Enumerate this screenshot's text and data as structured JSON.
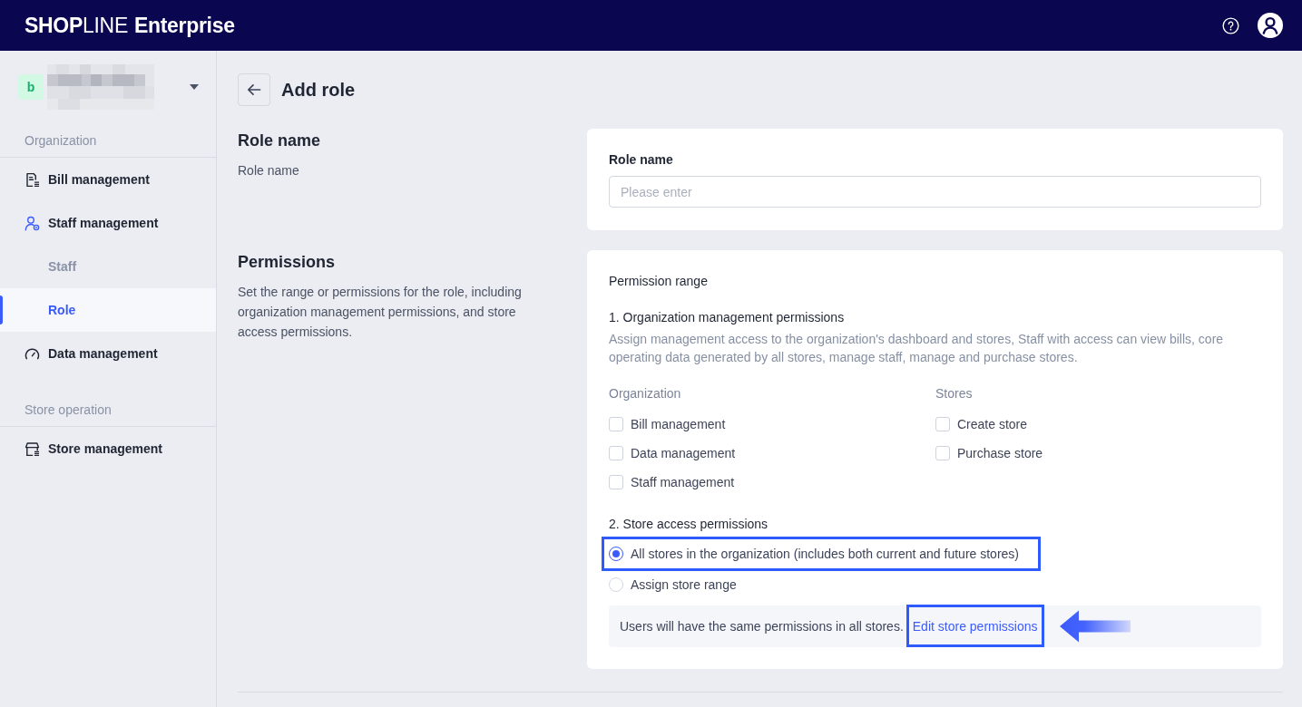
{
  "header": {
    "logo": {
      "brand": "**SHOP**LINE",
      "product": "Enterprise"
    }
  },
  "sidebar": {
    "org_switcher": {
      "initial": "b"
    },
    "sections": [
      {
        "label": "Organization",
        "items": [
          {
            "label": "Bill management",
            "kind": "bills",
            "selected": false
          },
          {
            "label": "Staff management",
            "kind": "staff",
            "selected": false,
            "children": [
              {
                "label": "Staff",
                "selected": false
              },
              {
                "label": "Role",
                "selected": true
              }
            ]
          },
          {
            "label": "Data management",
            "kind": "data",
            "selected": false
          }
        ]
      },
      {
        "label": "Store operation",
        "items": [
          {
            "label": "Store management",
            "kind": "store",
            "selected": false
          }
        ]
      }
    ]
  },
  "page": {
    "title": "Add role"
  },
  "role_name_section": {
    "heading": "Role name",
    "description": "Role name",
    "field": {
      "label": "Role name",
      "placeholder": "Please enter"
    }
  },
  "permissions_section": {
    "heading": "Permissions",
    "description": "Set the range or permissions for the role, including organization management permissions, and store access permissions.",
    "card": {
      "title": "Permission range",
      "org_permissions": {
        "heading": "1. Organization management permissions",
        "description": "Assign management access to the organization's dashboard and stores, Staff with access can view bills, core operating data generated by all stores, manage staff, manage and purchase stores.",
        "groups": [
          {
            "label": "Organization",
            "options": [
              {
                "label": "Bill management",
                "checked": false
              },
              {
                "label": "Data management",
                "checked": false
              },
              {
                "label": "Staff management",
                "checked": false
              }
            ]
          },
          {
            "label": "Stores",
            "options": [
              {
                "label": "Create store",
                "checked": false
              },
              {
                "label": "Purchase store",
                "checked": false
              }
            ]
          }
        ]
      },
      "store_access": {
        "heading": "2. Store access permissions",
        "options": [
          {
            "label": "All stores in the organization (includes both current and future stores)",
            "selected": true,
            "highlighted": true
          },
          {
            "label": "Assign store range",
            "selected": false,
            "highlighted": false
          }
        ],
        "notice": {
          "text": "Users will have the same permissions in all stores.",
          "link": {
            "text": "Edit store permissions",
            "highlighted": true,
            "pointed_at": true
          }
        }
      }
    }
  }
}
